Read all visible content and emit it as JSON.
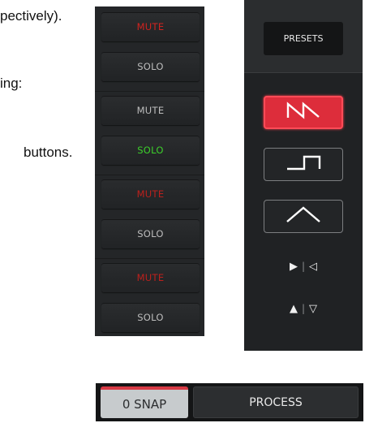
{
  "document_text": {
    "line1": "pectively).",
    "line2": "ing:",
    "line3": "buttons."
  },
  "strip": {
    "groups": [
      {
        "mute": "MUTE",
        "solo": "SOLO",
        "mute_state": "active",
        "solo_state": "off"
      },
      {
        "mute": "MUTE",
        "solo": "SOLO",
        "mute_state": "off",
        "solo_state": "active"
      },
      {
        "mute": "MUTE",
        "solo": "SOLO",
        "mute_state": "active",
        "solo_state": "off"
      },
      {
        "mute": "MUTE",
        "solo": "SOLO",
        "mute_state": "active",
        "solo_state": "off"
      }
    ]
  },
  "panel": {
    "presets_label": "PRESETS",
    "shapes": [
      {
        "icon": "sawtooth-wave-icon",
        "active": true
      },
      {
        "icon": "square-wave-icon",
        "active": false
      },
      {
        "icon": "triangle-wave-icon",
        "active": false
      }
    ],
    "play_arrows": {
      "left": "▶",
      "sep": "|",
      "right": "◁"
    },
    "updown_arrows": {
      "left": "▲",
      "sep": "|",
      "right": "▽"
    }
  },
  "bottom": {
    "snap_label": "0 SNAP",
    "process_label": "PROCESS"
  },
  "colors": {
    "accent_red": "#dd2d3b",
    "mute_red": "#d0231f",
    "solo_green": "#3ccf2b"
  }
}
